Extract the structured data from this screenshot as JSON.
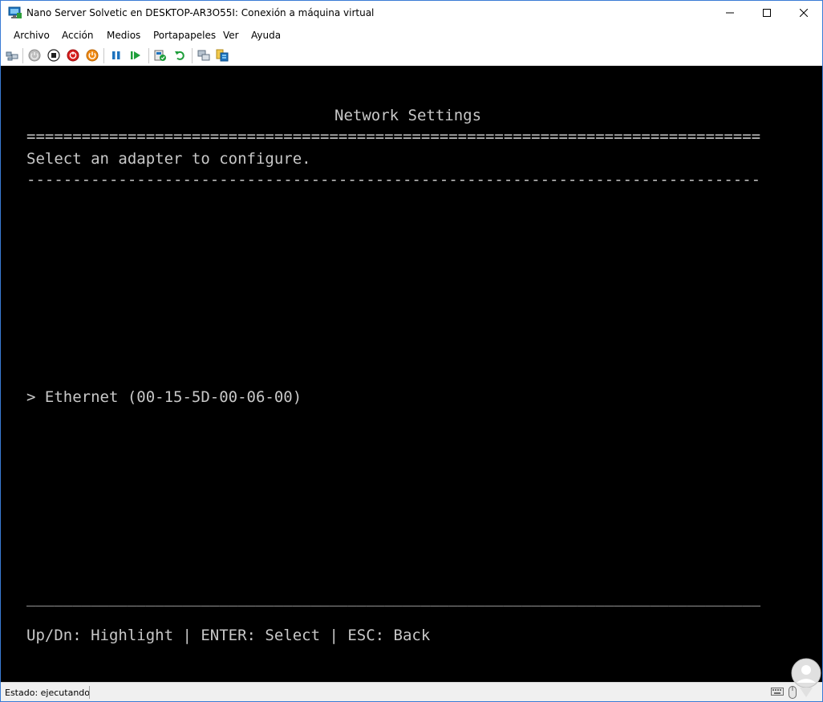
{
  "window": {
    "title": "Nano Server Solvetic en DESKTOP-AR3O55I: Conexión a máquina virtual"
  },
  "menu": [
    {
      "label": "Archivo"
    },
    {
      "label": "Acción"
    },
    {
      "label": "Medios"
    },
    {
      "label": "Portapapeles"
    },
    {
      "label": "Ver"
    },
    {
      "label": "Ayuda"
    }
  ],
  "toolbar": {
    "icons": [
      "ctrl-alt-del-icon",
      "start-icon",
      "turn-off-icon",
      "shutdown-icon",
      "save-icon",
      "pause-icon",
      "resume-icon",
      "checkpoint-icon",
      "revert-icon",
      "enhanced-session-icon",
      "share-icon"
    ]
  },
  "console": {
    "heading": "Network Settings",
    "double_rule": "================================================================================",
    "prompt": "Select an adapter to configure.",
    "single_rule": "--------------------------------------------------------------------------------",
    "adapter": "> Ethernet (00-15-5D-00-06-00)",
    "bottom_rule": "________________________________________________________________________________",
    "keys": "Up/Dn: Highlight | ENTER: Select | ESC: Back",
    "bg_color": "#000000",
    "fg_color": "#c8c8c8"
  },
  "status": {
    "text": "Estado: ejecutando"
  }
}
